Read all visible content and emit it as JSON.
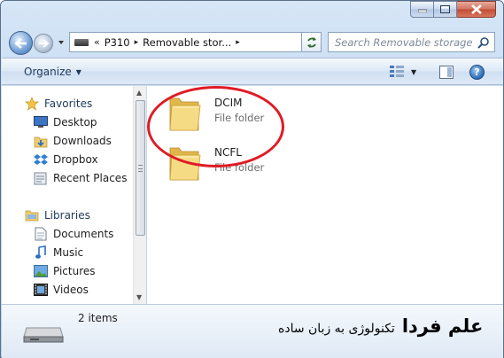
{
  "window": {
    "controls": {
      "minimize_icon": "minimize-icon",
      "maximize_icon": "maximize-icon",
      "close_icon": "close-icon"
    }
  },
  "nav": {
    "back_icon": "back-arrow-icon",
    "forward_icon": "forward-arrow-icon"
  },
  "address": {
    "overflow": "«",
    "crumbs": [
      "P310",
      "Removable stor..."
    ],
    "separator": "▸"
  },
  "search": {
    "placeholder": "Search Removable storage"
  },
  "toolbar": {
    "organize_label": "Organize"
  },
  "sidebar": {
    "groups": [
      {
        "label": "Favorites",
        "icon": "star-icon",
        "items": [
          {
            "label": "Desktop",
            "icon": "desktop-icon"
          },
          {
            "label": "Downloads",
            "icon": "downloads-icon"
          },
          {
            "label": "Dropbox",
            "icon": "dropbox-icon"
          },
          {
            "label": "Recent Places",
            "icon": "recent-places-icon"
          }
        ]
      },
      {
        "label": "Libraries",
        "icon": "libraries-icon",
        "items": [
          {
            "label": "Documents",
            "icon": "documents-icon"
          },
          {
            "label": "Music",
            "icon": "music-icon"
          },
          {
            "label": "Pictures",
            "icon": "pictures-icon"
          },
          {
            "label": "Videos",
            "icon": "videos-icon"
          }
        ]
      }
    ]
  },
  "files": [
    {
      "name": "DCIM",
      "type": "File folder",
      "icon": "folder-icon",
      "highlighted": true
    },
    {
      "name": "NCFL",
      "type": "File folder",
      "icon": "folder-icon",
      "highlighted": false
    }
  ],
  "details": {
    "count": "2 items",
    "icon": "removable-drive-icon"
  },
  "watermark": {
    "brand": "علم فردا",
    "tagline": "تکنولوژی به زبان ساده"
  },
  "colors": {
    "highlight": "#e01b24",
    "accent": "#1e395b",
    "folder": "#f3d57a"
  }
}
